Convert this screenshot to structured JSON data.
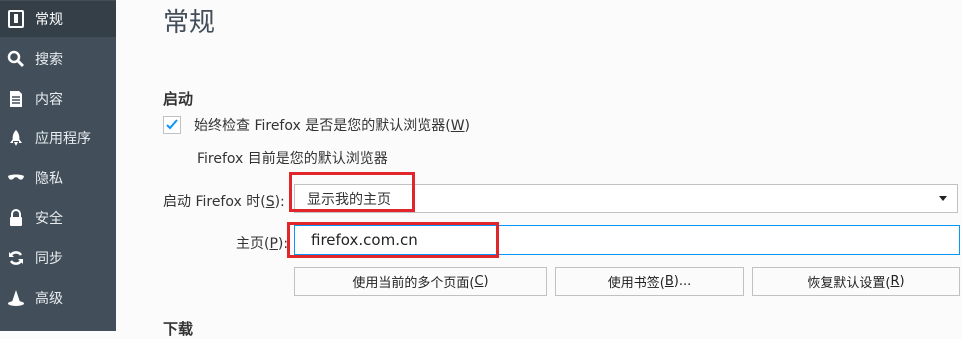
{
  "sidebar": {
    "items": [
      {
        "label": "常规",
        "icon": "general-icon"
      },
      {
        "label": "搜索",
        "icon": "search-icon"
      },
      {
        "label": "内容",
        "icon": "content-icon"
      },
      {
        "label": "应用程序",
        "icon": "rocket-icon"
      },
      {
        "label": "隐私",
        "icon": "mask-icon"
      },
      {
        "label": "安全",
        "icon": "lock-icon"
      },
      {
        "label": "同步",
        "icon": "sync-icon"
      },
      {
        "label": "高级",
        "icon": "wizard-hat-icon"
      }
    ],
    "selected_index": 0
  },
  "main": {
    "title": "常规",
    "startup": {
      "heading": "启动",
      "default_check_label": "始终检查 Firefox 是否是您的默认浏览器(",
      "default_check_key": "W",
      "default_check_close": ")",
      "default_check_checked": true,
      "status": "Firefox 目前是您的默认浏览器",
      "when_starts_label": "启动 Firefox 时(",
      "when_starts_key": "S",
      "when_starts_close": "):",
      "when_starts_value": "显示我的主页",
      "homepage_label": "主页(",
      "homepage_key": "P",
      "homepage_close": "):",
      "homepage_value": "firefox.com.cn",
      "buttons": {
        "use_current": {
          "label": "使用当前的多个页面(",
          "key": "C",
          "close": ")"
        },
        "use_bookmark": {
          "label": "使用书签(",
          "key": "B",
          "close": ")..."
        },
        "restore_default": {
          "label": "恢复默认设置(",
          "key": "R",
          "close": ")"
        }
      }
    },
    "downloads_heading": "下载"
  },
  "colors": {
    "sidebar_bg": "#424f5a",
    "sidebar_selected": "#343f48",
    "accent": "#0996f8",
    "highlight": "#e0262b"
  }
}
